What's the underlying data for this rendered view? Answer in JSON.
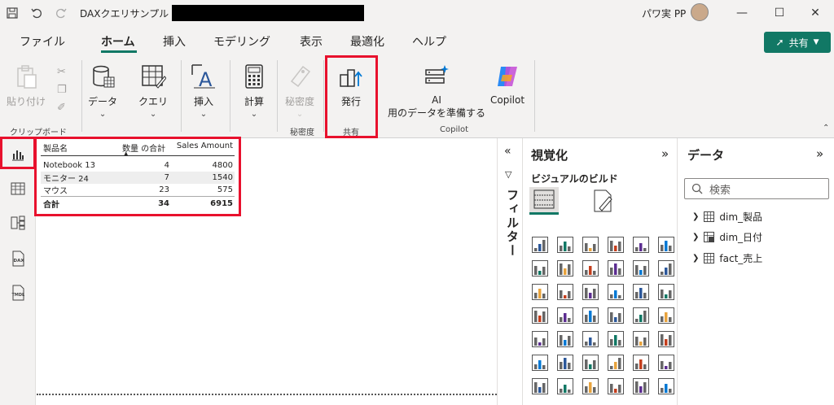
{
  "titlebar": {
    "file_name": "DAXクエリサンプル",
    "user_name": "パワ実 PP",
    "save_icon": "save-icon",
    "undo_icon": "undo-icon",
    "redo_icon": "redo-icon"
  },
  "menu": {
    "tabs": [
      "ファイル",
      "ホーム",
      "挿入",
      "モデリング",
      "表示",
      "最適化",
      "ヘルプ"
    ],
    "active": "ホーム",
    "share_label": "共有"
  },
  "ribbon": {
    "paste": "貼り付け",
    "data": "データ",
    "query": "クエリ",
    "insert": "挿入",
    "calc": "計算",
    "sensitivity": "秘密度",
    "publish": "発行",
    "ai_line1": "AI",
    "ai_line2": "用のデータを準備する",
    "copilot": "Copilot",
    "groups": {
      "clipboard": "クリップボード",
      "sensitivity": "秘密度",
      "share": "共有",
      "copilot": "Copilot"
    }
  },
  "table_visual": {
    "columns": [
      "製品名",
      "数量 の合計",
      "Sales Amount"
    ],
    "rows": [
      [
        "Notebook 13",
        "4",
        "4800"
      ],
      [
        "モニター 24",
        "7",
        "1540"
      ],
      [
        "マウス",
        "23",
        "575"
      ]
    ],
    "total": [
      "合計",
      "34",
      "6915"
    ]
  },
  "filter_pane": {
    "label": "フィルター"
  },
  "viz_pane": {
    "title": "視覚化",
    "subtitle": "ビジュアルのビルド"
  },
  "data_pane": {
    "title": "データ",
    "search_placeholder": "検索",
    "tables": [
      "dim_製品",
      "dim_日付",
      "fact_売上"
    ]
  },
  "colors": {
    "accent": "#117865",
    "highlight": "#e8112d",
    "chrome": "#f3f2f1"
  }
}
